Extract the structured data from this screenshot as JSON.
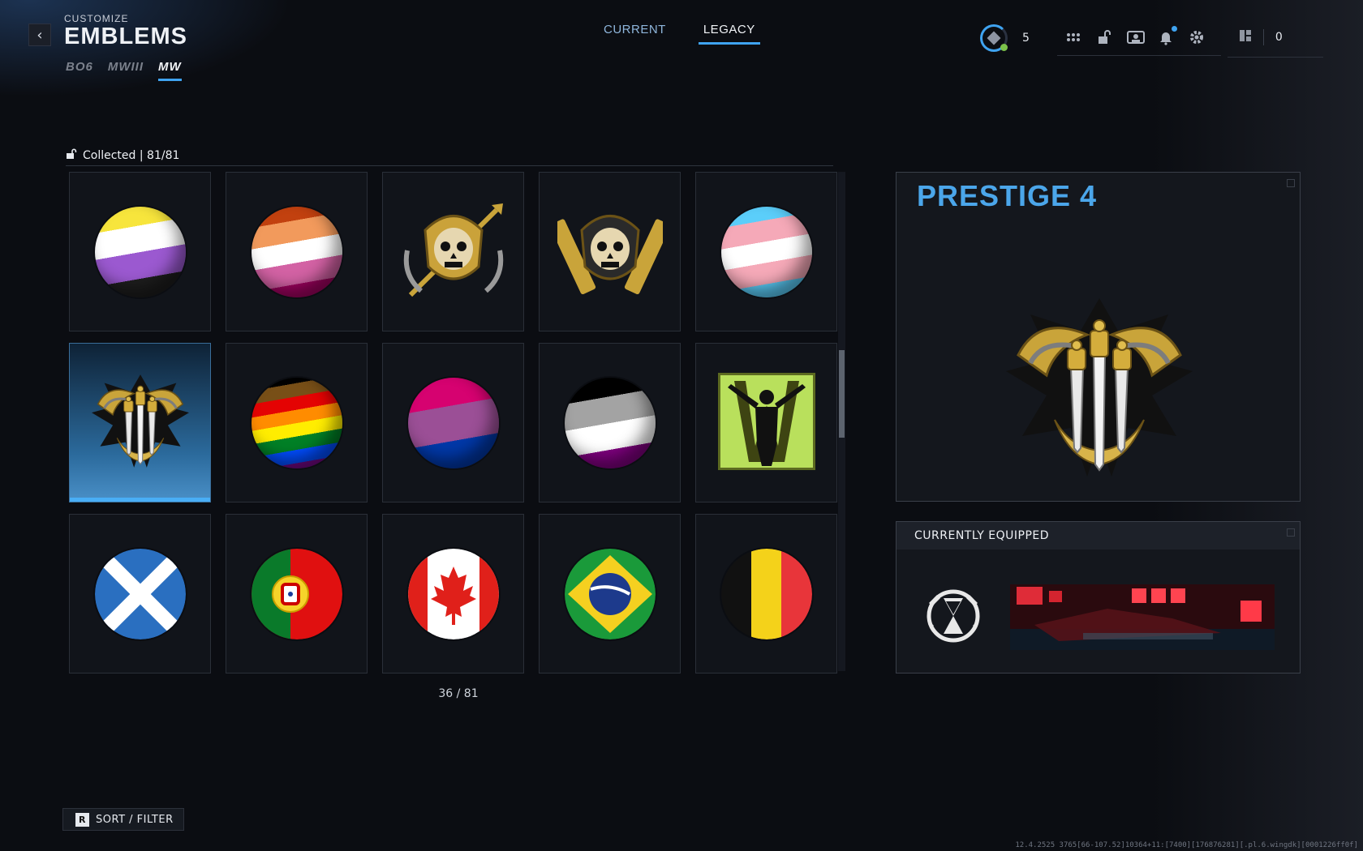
{
  "header": {
    "subtitle": "CUSTOMIZE",
    "title": "EMBLEMS",
    "game_tabs": [
      {
        "label": "BO6",
        "active": false
      },
      {
        "label": "MWIII",
        "active": false
      },
      {
        "label": "MW",
        "active": true
      }
    ],
    "mode_tabs": [
      {
        "label": "CURRENT",
        "active": false
      },
      {
        "label": "LEGACY",
        "active": true
      }
    ]
  },
  "hud": {
    "rank_value": "5",
    "currency_value": "0",
    "icons": [
      "menu-grid-icon",
      "unlock-icon",
      "social-icon",
      "notification-bell-icon",
      "settings-gear-icon"
    ]
  },
  "collection": {
    "label": "Collected | 81/81",
    "page_counter": "36 / 81"
  },
  "emblems": [
    {
      "name": "nonbinary-flag-emblem",
      "type": "flag",
      "stripes": [
        "#f7e53c",
        "#ffffff",
        "#9b59d0",
        "#1e1e1e"
      ]
    },
    {
      "name": "lesbian-flag-emblem",
      "type": "flag",
      "stripes": [
        "#c2410f",
        "#f29a5c",
        "#ffffff",
        "#d362a4",
        "#a30262"
      ]
    },
    {
      "name": "hooded-skull-emblem",
      "type": "gold-skull"
    },
    {
      "name": "rifles-skull-emblem",
      "type": "gold-skull-rifles"
    },
    {
      "name": "transgender-flag-emblem",
      "type": "flag",
      "stripes": [
        "#5bcefa",
        "#f5a9b8",
        "#ffffff",
        "#f5a9b8",
        "#5bcefa"
      ]
    },
    {
      "name": "prestige-4-emblem",
      "type": "prestige",
      "selected": true
    },
    {
      "name": "progress-pride-flag-emblem",
      "type": "flag",
      "stripes": [
        "#000000",
        "#784f17",
        "#e40303",
        "#ff8c00",
        "#ffed00",
        "#008026",
        "#004dff",
        "#750787"
      ]
    },
    {
      "name": "bisexual-flag-emblem",
      "type": "flag",
      "stripes": [
        "#d60270",
        "#9b4f96",
        "#0038a8"
      ]
    },
    {
      "name": "asexual-flag-emblem",
      "type": "flag",
      "stripes": [
        "#000000",
        "#a3a3a3",
        "#ffffff",
        "#800080"
      ]
    },
    {
      "name": "soldier-w-emblem",
      "type": "soldier-w"
    },
    {
      "name": "scotland-flag-emblem",
      "type": "scotland"
    },
    {
      "name": "portugal-flag-emblem",
      "type": "portugal"
    },
    {
      "name": "canada-flag-emblem",
      "type": "canada"
    },
    {
      "name": "brazil-flag-emblem",
      "type": "brazil"
    },
    {
      "name": "belgium-flag-emblem",
      "type": "belgium"
    }
  ],
  "preview": {
    "title": "PRESTIGE 4"
  },
  "equipped": {
    "heading": "CURRENTLY EQUIPPED",
    "emblem_icon": "hourglass-reaper-icon"
  },
  "footer": {
    "sort_key": "R",
    "sort_label": "SORT / FILTER",
    "build_string": "12.4.2525 3765[66-107.52]10364+11:[7400][176876281][.pl.6.wingdk][0001226ff0f]"
  },
  "colors": {
    "accent": "#3fa3f0",
    "title_blue": "#4ba6ea",
    "background": "#0b0d12"
  }
}
